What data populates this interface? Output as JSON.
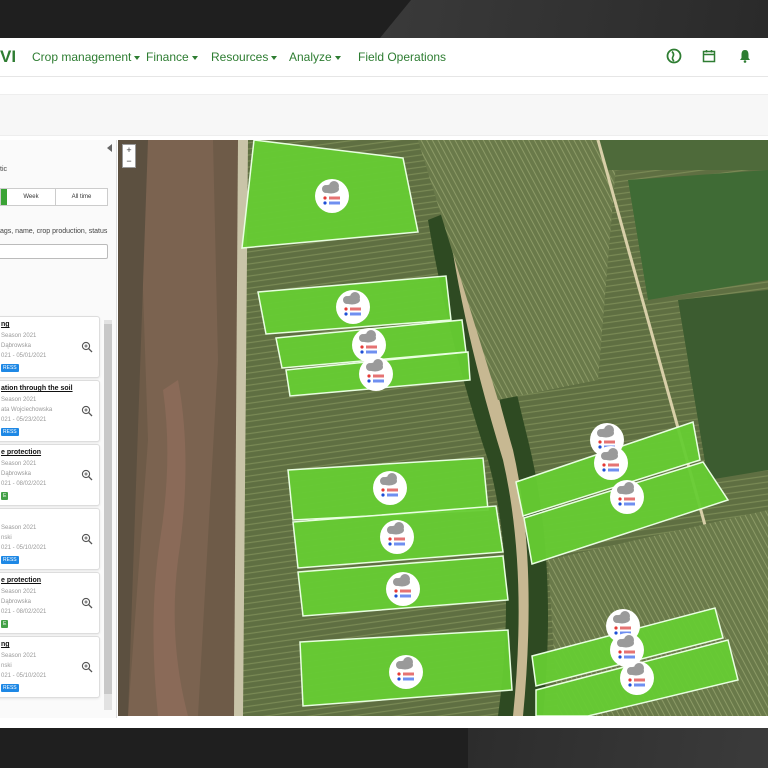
{
  "nav": {
    "logo": "VI",
    "items": [
      {
        "label": "Crop management",
        "dropdown": true
      },
      {
        "label": "Finance",
        "dropdown": true
      },
      {
        "label": "Resources",
        "dropdown": true
      },
      {
        "label": "Analyze",
        "dropdown": true
      },
      {
        "label": "Field Operations",
        "dropdown": false
      }
    ],
    "icons": [
      "globe-icon",
      "calendar-icon",
      "bell-icon"
    ],
    "accent": "#2e7d32"
  },
  "sidebar": {
    "filter_label": "tic",
    "period": {
      "week": "Week",
      "all_time": "All time"
    },
    "search_label": "ags, name, crop production, status",
    "cards": [
      {
        "title": "ng",
        "lines": [
          "Season 2021",
          "Dąbrowska",
          "021 - 05/01/2021"
        ],
        "badge": "RESS",
        "badge_color": "blue"
      },
      {
        "title": "ation through the soil",
        "lines": [
          "Season 2021",
          "ata Wojciechowska",
          "021 - 05/23/2021"
        ],
        "badge": "RESS",
        "badge_color": "blue"
      },
      {
        "title": "e protection",
        "lines": [
          "Season 2021",
          "Dąbrowska",
          "021 - 08/02/2021"
        ],
        "badge": "E",
        "badge_color": "green"
      },
      {
        "title": "",
        "lines": [
          "Season 2021",
          "nski",
          "021 - 05/10/2021"
        ],
        "badge": "RESS",
        "badge_color": "blue"
      },
      {
        "title": "e protection",
        "lines": [
          "Season 2021",
          "Dąbrowska",
          "021 - 08/02/2021"
        ],
        "badge": "E",
        "badge_color": "green"
      },
      {
        "title": "ng",
        "lines": [
          "Season 2021",
          "nski",
          "021 - 05/10/2021"
        ],
        "badge": "RESS",
        "badge_color": "blue"
      }
    ]
  },
  "map": {
    "zoom_in": "+",
    "zoom_out": "−",
    "field_color": "#66cc33",
    "weather": {
      "high": "12.0°C",
      "low": "12.0°C"
    }
  }
}
